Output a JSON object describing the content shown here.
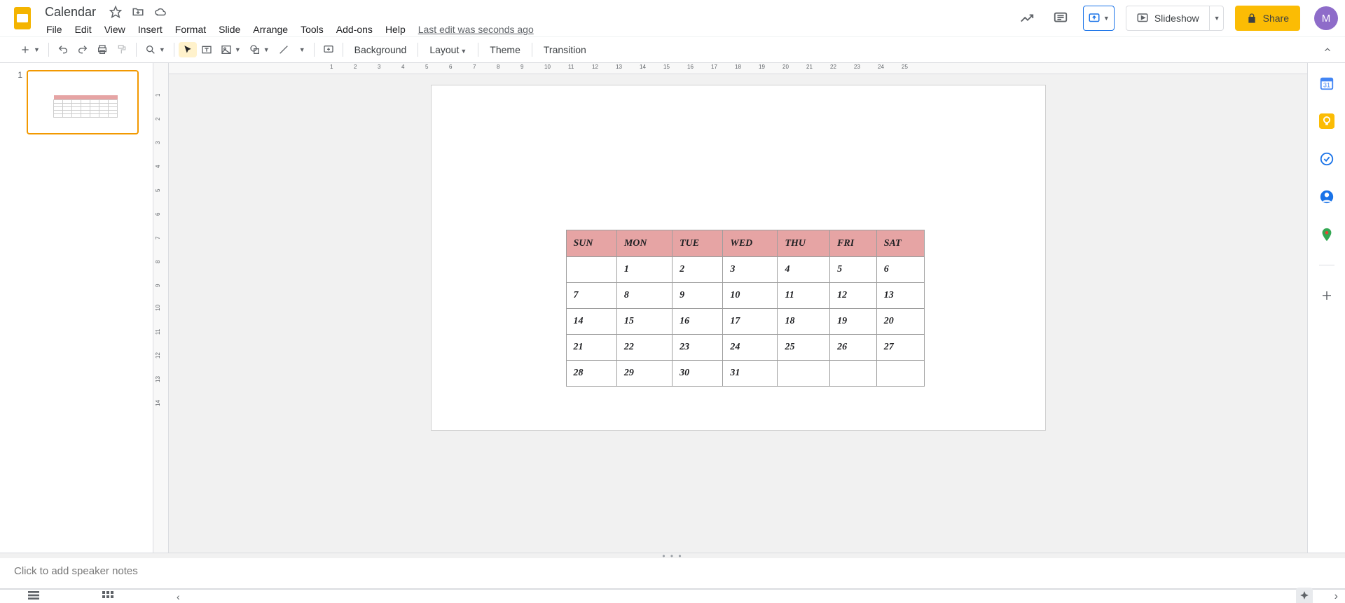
{
  "doc": {
    "title": "Calendar"
  },
  "menus": [
    "File",
    "Edit",
    "View",
    "Insert",
    "Format",
    "Slide",
    "Arrange",
    "Tools",
    "Add-ons",
    "Help"
  ],
  "last_edit": "Last edit was seconds ago",
  "header": {
    "slideshow_label": "Slideshow",
    "share_label": "Share",
    "avatar_initial": "M"
  },
  "toolbar": {
    "background": "Background",
    "layout": "Layout",
    "theme": "Theme",
    "transition": "Transition"
  },
  "filmstrip": {
    "slides": [
      {
        "num": "1"
      }
    ]
  },
  "notes": {
    "placeholder": "Click to add speaker notes"
  },
  "calendar": {
    "headers": [
      "SUN",
      "MON",
      "TUE",
      "WED",
      "THU",
      "FRI",
      "SAT"
    ],
    "rows": [
      [
        "",
        "1",
        "2",
        "3",
        "4",
        "5",
        "6"
      ],
      [
        "7",
        "8",
        "9",
        "10",
        "11",
        "12",
        "13"
      ],
      [
        "14",
        "15",
        "16",
        "17",
        "18",
        "19",
        "20"
      ],
      [
        "21",
        "22",
        "23",
        "24",
        "25",
        "26",
        "27"
      ],
      [
        "28",
        "29",
        "30",
        "31",
        "",
        "",
        ""
      ]
    ]
  },
  "rulers": {
    "h": [
      "1",
      "2",
      "3",
      "4",
      "5",
      "6",
      "7",
      "8",
      "9",
      "10",
      "11",
      "12",
      "13",
      "14",
      "15",
      "16",
      "17",
      "18",
      "19",
      "20",
      "21",
      "22",
      "23",
      "24",
      "25"
    ],
    "v": [
      "1",
      "2",
      "3",
      "4",
      "5",
      "6",
      "7",
      "8",
      "9",
      "10",
      "11",
      "12",
      "13",
      "14"
    ]
  }
}
